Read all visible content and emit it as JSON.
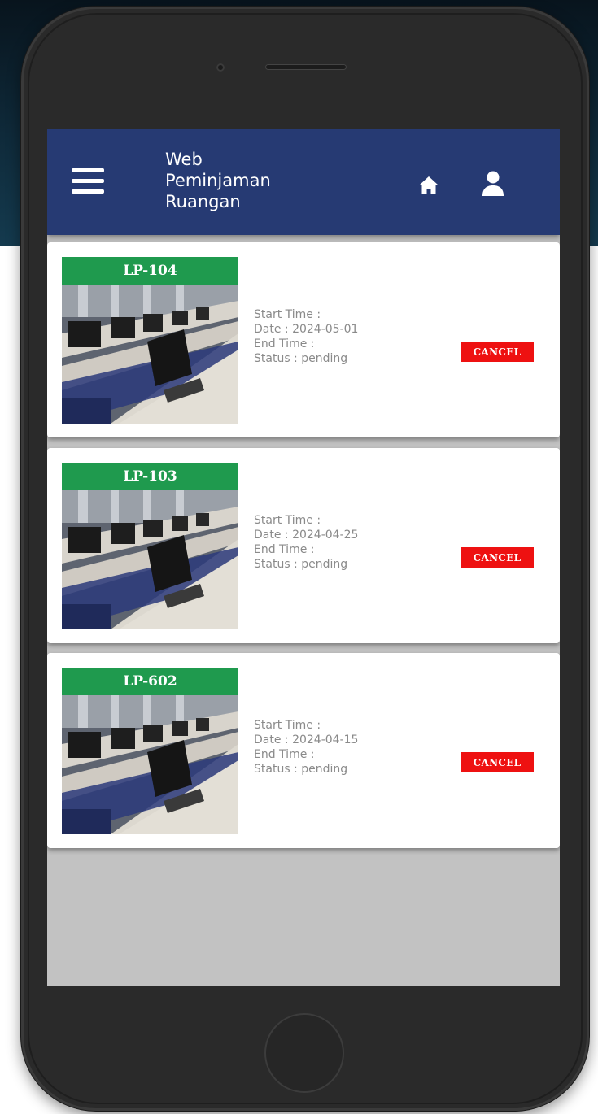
{
  "app": {
    "title_lines": [
      "Web",
      "Peminjaman",
      "Ruangan"
    ]
  },
  "icons": {
    "menu": "hamburger-menu-icon",
    "home": "home-icon",
    "user": "user-icon"
  },
  "colors": {
    "navbar": "#263a73",
    "room_label": "#1f9a4e",
    "cancel": "#ee1111",
    "screen_bg": "#c2c2c2"
  },
  "bookings": [
    {
      "room": "LP-104",
      "start_time": "Start Time :",
      "date": "Date : 2024-05-01",
      "end_time": "End Time :",
      "status": "Status : pending",
      "cancel_label": "CANCEL"
    },
    {
      "room": "LP-103",
      "start_time": "Start Time :",
      "date": "Date : 2024-04-25",
      "end_time": "End Time :",
      "status": "Status : pending",
      "cancel_label": "CANCEL"
    },
    {
      "room": "LP-602",
      "start_time": "Start Time :",
      "date": "Date : 2024-04-15",
      "end_time": "End Time :",
      "status": "Status : pending",
      "cancel_label": "CANCEL"
    }
  ]
}
